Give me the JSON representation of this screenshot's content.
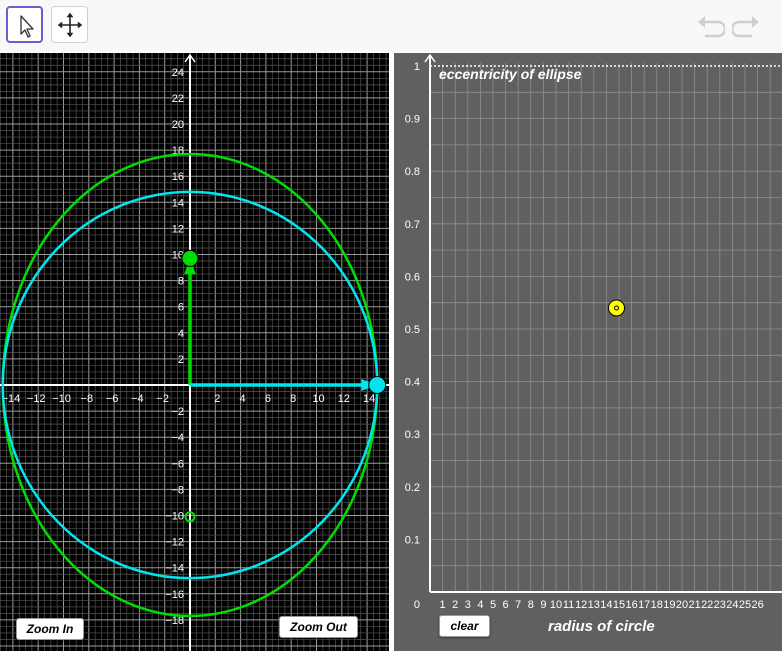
{
  "toolbar": {
    "tools": [
      {
        "name": "select",
        "icon": "arrow-pointer-icon",
        "active": true
      },
      {
        "name": "move-graphics-view",
        "icon": "move-arrows-icon",
        "active": false
      }
    ],
    "history": {
      "undo_icon": "undo-icon",
      "redo_icon": "redo-icon"
    }
  },
  "graphics1": {
    "x_tick_labels": [
      "−14",
      "−12",
      "−10",
      "−8",
      "−6",
      "−4",
      "−2",
      "2",
      "4",
      "6",
      "8",
      "10",
      "12",
      "14"
    ],
    "y_tick_labels_pos": [
      "2",
      "4",
      "6",
      "8",
      "10",
      "12",
      "14",
      "16",
      "18",
      "20",
      "22",
      "24"
    ],
    "y_tick_labels_neg": [
      "−2",
      "−4",
      "−6",
      "−8",
      "−10",
      "−12",
      "−14",
      "−16",
      "−18"
    ],
    "circle": {
      "radius": 14.8,
      "color": "#00e5ee"
    },
    "ellipse": {
      "semi_major_y": 17.7,
      "semi_minor_x": 14.8,
      "color": "#00dd00"
    },
    "vector_vertical": {
      "from": [
        0,
        0
      ],
      "to": [
        0,
        9.7
      ],
      "color": "#00dd00"
    },
    "vector_horizontal": {
      "from": [
        0,
        0
      ],
      "to": [
        14.8,
        0
      ],
      "color": "#00e5ee"
    },
    "point_top": [
      0,
      9.7
    ],
    "point_bottom": [
      0,
      -10.1
    ],
    "zoom_in_label": "Zoom In",
    "zoom_out_label": "Zoom Out"
  },
  "graphics2": {
    "y_axis_label": "eccentricity of ellipse",
    "x_axis_label": "radius of circle",
    "y_tick_labels": [
      "0.1",
      "0.2",
      "0.3",
      "0.4",
      "0.5",
      "0.6",
      "0.7",
      "0.8",
      "0.9",
      "1"
    ],
    "origin_label": "0",
    "x_tick_labels": [
      "1",
      "2",
      "3",
      "4",
      "5",
      "6",
      "7",
      "8",
      "9",
      "10",
      "11",
      "12",
      "13",
      "14",
      "15",
      "16",
      "17",
      "18",
      "19",
      "20",
      "21",
      "22",
      "23",
      "24",
      "25",
      "26"
    ],
    "point": {
      "x": 14.8,
      "y": 0.54,
      "color": "#ffff00"
    },
    "clear_label": "clear"
  }
}
